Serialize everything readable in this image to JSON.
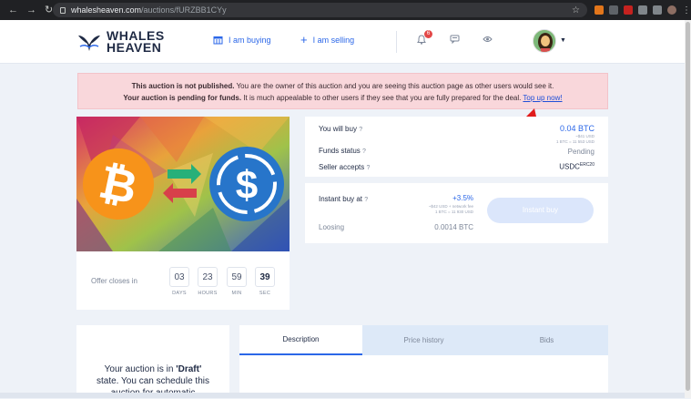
{
  "browser": {
    "url_host": "whalesheaven.com",
    "url_path": "/auctions/fURZBB1CYy",
    "back_icon": "arrow-left-icon",
    "forward_icon": "arrow-right-icon",
    "reload_icon": "reload-icon",
    "star_icon": "star-icon"
  },
  "header": {
    "logo_line1": "WHALES",
    "logo_line2": "HEAVEN",
    "buying_label": "I am buying",
    "selling_label": "I am selling",
    "notification_count": "6"
  },
  "alert": {
    "line1_bold": "This auction is not published.",
    "line1_rest": " You are the owner of this auction and you are seeing this auction page as other users would see it.",
    "line2_bold": "Your auction is pending for funds.",
    "line2_rest": " It is much appealable to other users if they see that you are fully prepared for the deal.",
    "link": "Top up now!"
  },
  "timer": {
    "label": "Offer closes in",
    "days": "03",
    "days_unit": "DAYS",
    "hours": "23",
    "hours_unit": "HOURS",
    "minutes": "59",
    "minutes_unit": "MIN",
    "seconds": "39",
    "seconds_unit": "SEC"
  },
  "info": {
    "you_will_buy_label": "You will buy",
    "you_will_buy_value": "0.04 BTC",
    "you_will_buy_sub1": "~$41 USD",
    "you_will_buy_sub2": "1 BTC = 11 553 USD",
    "funds_status_label": "Funds status",
    "funds_status_value": "Pending",
    "seller_accepts_label": "Seller accepts",
    "seller_accepts_value": "USDC",
    "seller_accepts_sup": "ERC20",
    "q": "?"
  },
  "instant": {
    "label": "Instant buy at",
    "percent": "+3.5%",
    "sub1": "~$42 USD + network fee",
    "sub2": "1 BTC = 11 930 USD",
    "loosing_label": "Loosing",
    "loosing_value": "0.0014 BTC",
    "button": "Instant buy"
  },
  "draft": {
    "line1": "Your auction is in ",
    "bold": "'Draft'",
    "line2": "state. You can schedule this",
    "line3": "auction for automatic"
  },
  "tabs": [
    "Description",
    "Price history",
    "Bids"
  ],
  "colors": {
    "accent": "#2b67e8",
    "bitcoin": "#f7931a",
    "usdc": "#2775ca",
    "alert_bg": "#f9d7db"
  }
}
